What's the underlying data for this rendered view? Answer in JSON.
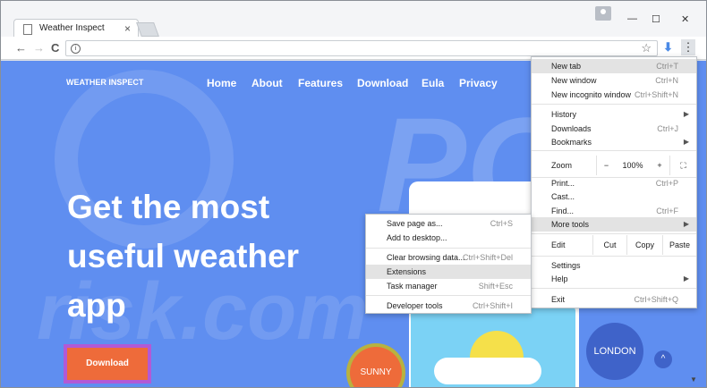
{
  "browser": {
    "tab_title": "Weather Inspect",
    "tab_close": "×",
    "win_min": "—",
    "win_max": "☐",
    "win_close": "✕",
    "nav_back": "←",
    "nav_forward": "→",
    "nav_reload": "C",
    "info": "i",
    "star": "☆",
    "download": "⬇",
    "menu": "⋮"
  },
  "site": {
    "logo": "WEATHER INSPECT",
    "nav": [
      "Home",
      "About",
      "Features",
      "Download",
      "Eula",
      "Privacy"
    ],
    "hero": [
      "Get the most",
      "useful weather",
      "app"
    ],
    "download_button": "Download",
    "sunny": "SUNNY",
    "london": "LONDON",
    "up": "^",
    "scroll": "▼"
  },
  "chrome_menu": {
    "new_tab": {
      "label": "New tab",
      "shortcut": "Ctrl+T"
    },
    "new_window": {
      "label": "New window",
      "shortcut": "Ctrl+N"
    },
    "incognito": {
      "label": "New incognito window",
      "shortcut": "Ctrl+Shift+N"
    },
    "history": {
      "label": "History",
      "arrow": "▶"
    },
    "downloads": {
      "label": "Downloads",
      "shortcut": "Ctrl+J"
    },
    "bookmarks": {
      "label": "Bookmarks",
      "arrow": "▶"
    },
    "zoom": {
      "label": "Zoom",
      "minus": "−",
      "value": "100%",
      "plus": "+",
      "fullscreen": "⛶"
    },
    "print": {
      "label": "Print...",
      "shortcut": "Ctrl+P"
    },
    "cast": {
      "label": "Cast..."
    },
    "find": {
      "label": "Find...",
      "shortcut": "Ctrl+F"
    },
    "more_tools": {
      "label": "More tools",
      "arrow": "▶"
    },
    "edit": {
      "label": "Edit",
      "cut": "Cut",
      "copy": "Copy",
      "paste": "Paste"
    },
    "settings": {
      "label": "Settings"
    },
    "help": {
      "label": "Help",
      "arrow": "▶"
    },
    "exit": {
      "label": "Exit",
      "shortcut": "Ctrl+Shift+Q"
    }
  },
  "more_tools_menu": {
    "save_page": {
      "label": "Save page as...",
      "shortcut": "Ctrl+S"
    },
    "add_desktop": {
      "label": "Add to desktop..."
    },
    "clear_data": {
      "label": "Clear browsing data...",
      "shortcut": "Ctrl+Shift+Del"
    },
    "extensions": {
      "label": "Extensions"
    },
    "task_manager": {
      "label": "Task manager",
      "shortcut": "Shift+Esc"
    },
    "dev_tools": {
      "label": "Developer tools",
      "shortcut": "Ctrl+Shift+I"
    }
  }
}
